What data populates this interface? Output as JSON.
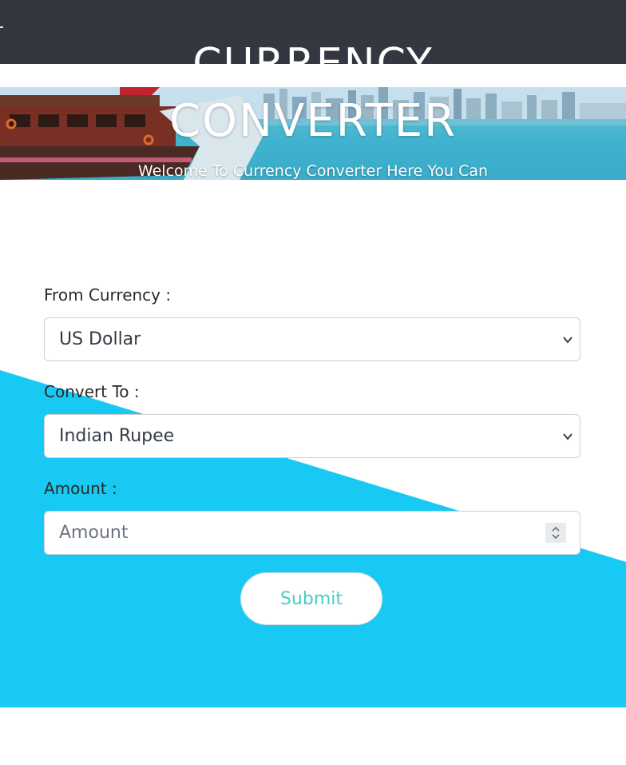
{
  "header": {
    "title_line1": "CURRENCY",
    "title_line2": "CONVERTER",
    "subtitle": "Welcome To Currency Converter Here You Can"
  },
  "form": {
    "from_label": "From Currency :",
    "from_value": "US Dollar",
    "to_label": "Convert To :",
    "to_value": "Indian Rupee",
    "amount_label": "Amount :",
    "amount_placeholder": "Amount",
    "submit_label": "Submit"
  },
  "colors": {
    "topbar": "#34373f",
    "accent_blue": "#18c9f3",
    "submit_text": "#49cec0"
  },
  "icons": {
    "from_select": "chevron-down-icon",
    "to_select": "chevron-down-icon",
    "amount_spinner": "spinner-icon"
  }
}
